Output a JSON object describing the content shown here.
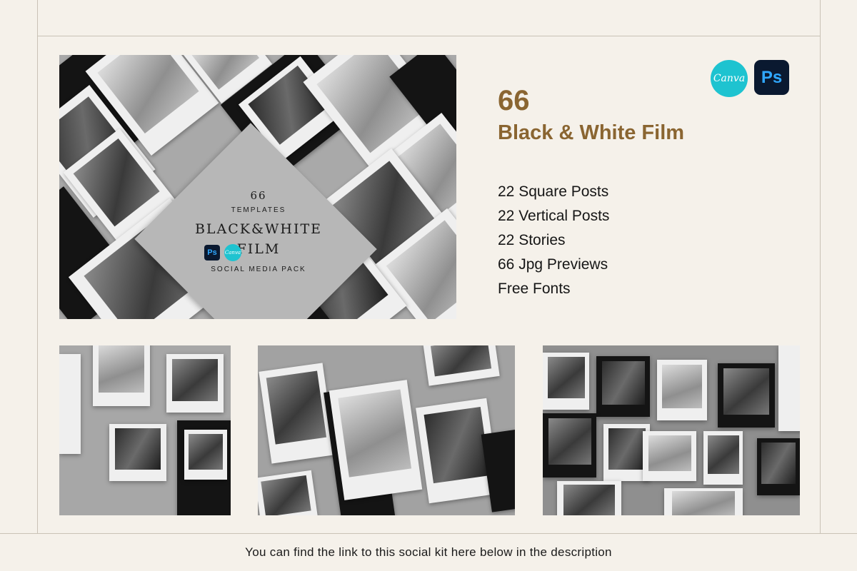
{
  "hero": {
    "count": "66",
    "templates_label": "TEMPLATES",
    "title_line1": "BLACK&WHITE",
    "title_line2": "FILM",
    "pack_label": "SOCIAL MEDIA PACK",
    "ps_badge": "Ps",
    "canva_badge": "Canva"
  },
  "apps": {
    "canva_label": "Canva",
    "ps_label": "Ps",
    "canva_color": "#1ec3d0",
    "ps_bg_color": "#0a1930",
    "ps_text_color": "#30a8ff"
  },
  "product": {
    "count": "66",
    "subtitle": "Black & White Film",
    "accent_color": "#8a6531",
    "features": [
      "22 Square Posts",
      "22 Vertical Posts",
      "22 Stories",
      "66 Jpg Previews",
      "Free Fonts"
    ]
  },
  "footer": {
    "caption": "You can find the link to this social kit here below in the description"
  }
}
